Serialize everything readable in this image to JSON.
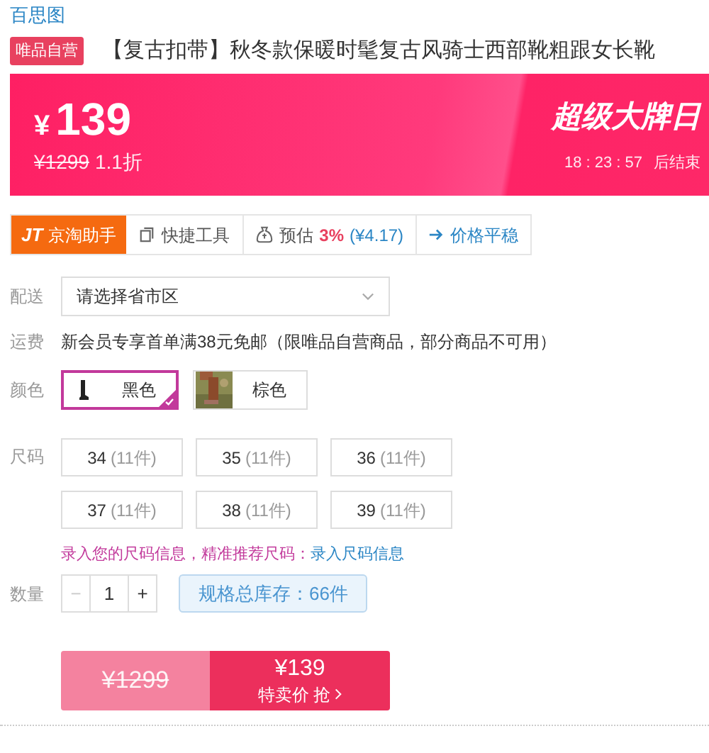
{
  "brand_link": "百思图",
  "badge": "唯品自营",
  "title": "【复古扣带】秋冬款保暖时髦复古风骑士西部靴粗跟女长靴",
  "promo": {
    "currency": "¥",
    "price": "139",
    "original_price": "¥1299",
    "discount": "1.1折",
    "event": "超级大牌日",
    "countdown": "18 : 23 : 57",
    "countdown_suffix": "后结束"
  },
  "tools": [
    {
      "kind": "brand",
      "logo": "JT",
      "label": "京淘助手"
    },
    {
      "kind": "tool",
      "label": "快捷工具"
    },
    {
      "kind": "estimate",
      "label": "预估",
      "rate": "3%",
      "amount": "(¥4.17)"
    },
    {
      "kind": "trend",
      "label": "价格平稳"
    }
  ],
  "delivery": {
    "label": "配送",
    "placeholder": "请选择省市区"
  },
  "shipping": {
    "label": "运费",
    "text": "新会员专享首单满38元免邮（限唯品自营商品，部分商品不可用）"
  },
  "colors": {
    "label": "颜色",
    "options": [
      {
        "name": "黑色",
        "kind": "icon",
        "selected": true
      },
      {
        "name": "棕色",
        "kind": "picture",
        "selected": false
      }
    ]
  },
  "sizes": {
    "label": "尺码",
    "options": [
      {
        "size": "34",
        "stock": "(11件)",
        "selected": false
      },
      {
        "size": "35",
        "stock": "(11件)",
        "selected": false
      },
      {
        "size": "36",
        "stock": "(11件)",
        "selected": false
      },
      {
        "size": "37",
        "stock": "(11件)",
        "selected": false
      },
      {
        "size": "38",
        "stock": "(11件)",
        "selected": false
      },
      {
        "size": "39",
        "stock": "(11件)",
        "selected": false
      }
    ]
  },
  "size_hint": {
    "text": "录入您的尺码信息，精准推荐尺码：",
    "link": "录入尺码信息"
  },
  "quantity": {
    "label": "数量",
    "minus": "−",
    "value": "1",
    "plus": "+",
    "minus_disabled": true,
    "stock": "规格总库存：66件"
  },
  "buy": {
    "original_price": "¥1299",
    "price": "¥139",
    "caption": "特卖价 抢"
  }
}
